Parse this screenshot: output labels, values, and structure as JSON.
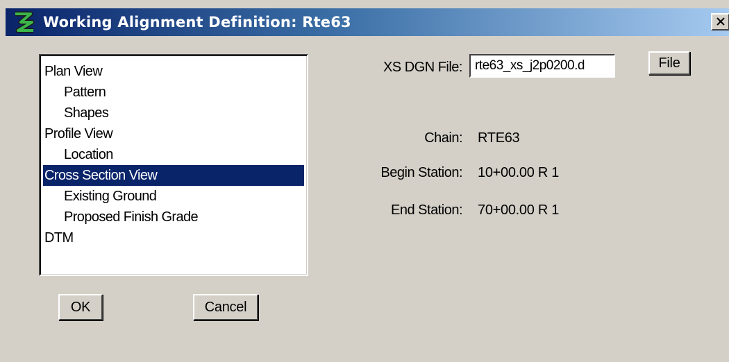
{
  "window": {
    "title": "Working Alignment Definition: Rte63",
    "close_symbol": "×"
  },
  "tree": {
    "items": [
      {
        "label": "Plan View",
        "level": 0,
        "selected": false
      },
      {
        "label": "Pattern",
        "level": 1,
        "selected": false
      },
      {
        "label": "Shapes",
        "level": 1,
        "selected": false
      },
      {
        "label": "Profile View",
        "level": 0,
        "selected": false
      },
      {
        "label": "Location",
        "level": 1,
        "selected": false
      },
      {
        "label": "Cross Section View",
        "level": 0,
        "selected": true
      },
      {
        "label": "Existing Ground",
        "level": 1,
        "selected": false
      },
      {
        "label": "Proposed Finish Grade",
        "level": 1,
        "selected": false
      },
      {
        "label": "DTM",
        "level": 0,
        "selected": false
      }
    ]
  },
  "form": {
    "xs_dgn_label": "XS DGN File:",
    "xs_dgn_value": "rte63_xs_j2p0200.d",
    "file_button": "File",
    "chain_label": "Chain:",
    "chain_value": "RTE63",
    "begin_label": "Begin Station:",
    "begin_value": "10+00.00 R 1",
    "end_label": "End Station:",
    "end_value": "70+00.00 R 1"
  },
  "buttons": {
    "ok": "OK",
    "cancel": "Cancel"
  },
  "colors": {
    "title_gradient_start": "#0a246a",
    "title_gradient_end": "#a6caf0",
    "selection": "#0a246a",
    "dialog_bg": "#d4d0c8",
    "app_icon": "#2e8b3e"
  },
  "icons": {
    "app": "bentley-geopak-icon",
    "close": "close-icon"
  }
}
